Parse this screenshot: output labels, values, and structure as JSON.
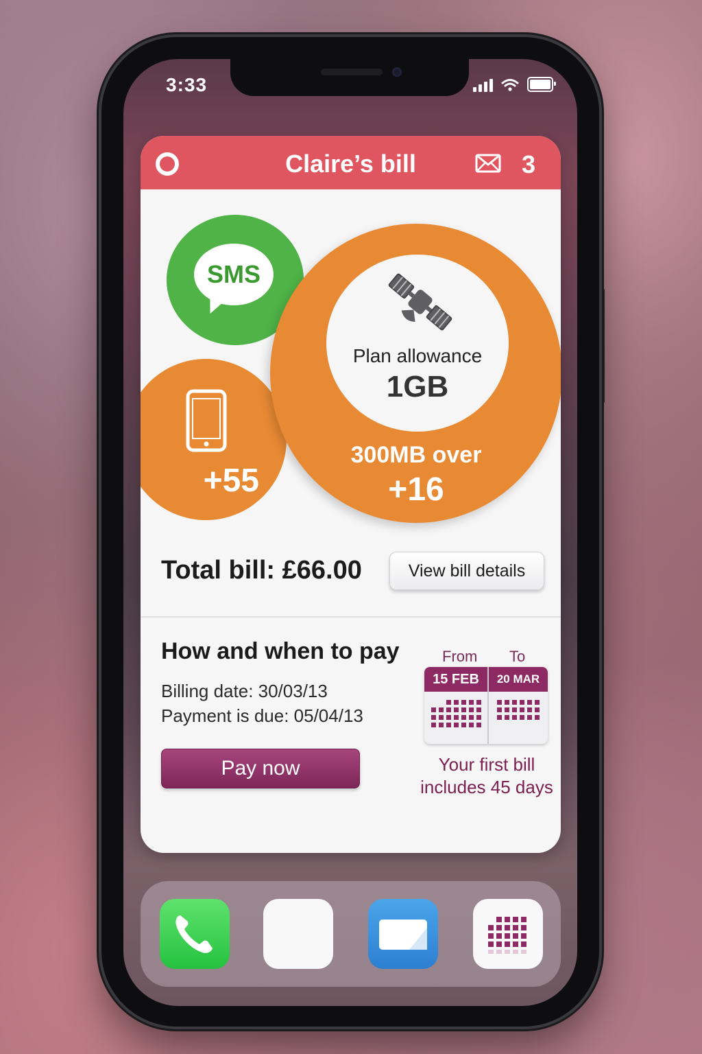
{
  "status_bar": {
    "time": "3:33"
  },
  "bill_card": {
    "title": "Claire’s bill",
    "message_count": "3",
    "usage": {
      "sms": {
        "label": "SMS"
      },
      "calls": {
        "value": "+55"
      },
      "data": {
        "plan_label": "Plan allowance",
        "plan_value": "1GB",
        "over_label": "300MB over",
        "over_value": "+16"
      }
    },
    "total_bill": "Total bill: £66.00",
    "view_details_label": "View bill details"
  },
  "payment": {
    "title": "How and when to pay",
    "billing_date": "Billing date: 30/03/13",
    "payment_due": "Payment is due: 05/04/13",
    "pay_now_label": "Pay now",
    "calendar": {
      "from_label": "From",
      "to_label": "To",
      "from_date": "15 FEB",
      "to_date": "20 MAR"
    },
    "first_bill_note": "Your first bill includes 45 days"
  },
  "colors": {
    "header": "#e05660",
    "sms_green": "#4fb347",
    "usage_orange": "#e88a34",
    "accent_purple": "#8e2a63"
  },
  "dock": {
    "icons": [
      "phone-app-icon",
      "blank-app-icon",
      "mail-app-icon",
      "grid-app-icon"
    ]
  }
}
